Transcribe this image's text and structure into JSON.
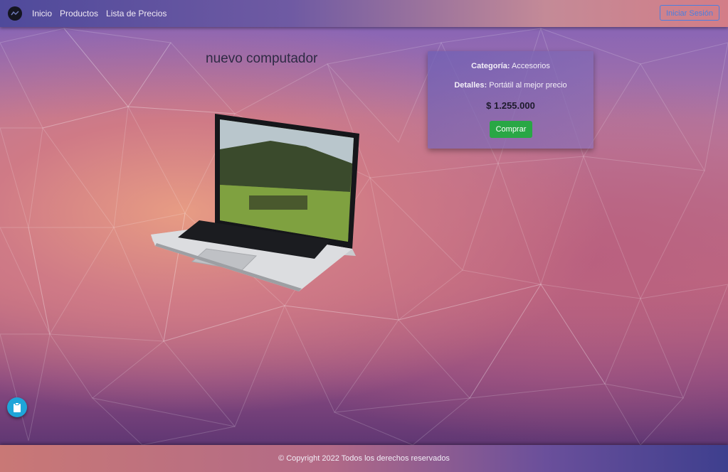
{
  "navbar": {
    "logo_icon": "brand-logo-icon",
    "links": [
      "Inicio",
      "Productos",
      "Lista de Precios"
    ],
    "login_label": "Iniciar Sesión"
  },
  "product": {
    "title": "nuevo computador",
    "category_label": "Categoría:",
    "category_value": "Accesorios",
    "details_label": "Detalles:",
    "details_value": "Portátil al mejor precio",
    "price": "$ 1.255.000",
    "buy_label": "Comprar"
  },
  "footer": {
    "text": "© Copyright 2022 Todos los derechos reservados"
  },
  "fab": {
    "icon": "clipboard-icon"
  },
  "colors": {
    "accent_blue": "#4a7fe0",
    "buy_green": "#29a745",
    "fab_blue": "#1ea5d9"
  }
}
